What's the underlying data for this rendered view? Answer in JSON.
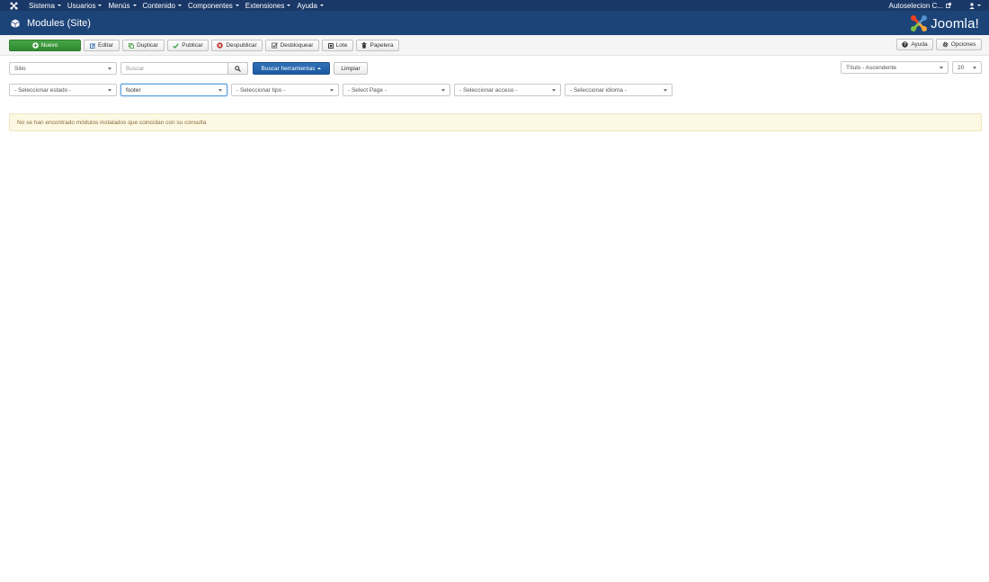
{
  "navbar": {
    "menus": [
      {
        "label": "Sistema"
      },
      {
        "label": "Usuarios"
      },
      {
        "label": "Menús"
      },
      {
        "label": "Contenido"
      },
      {
        "label": "Componentes"
      },
      {
        "label": "Extensiones"
      },
      {
        "label": "Ayuda"
      }
    ],
    "site_link": "Autoselecion C...",
    "user_icon": "user-icon"
  },
  "header": {
    "title": "Modules (Site)",
    "title_icon": "cube-icon",
    "brand": "Joomla!"
  },
  "toolbar": {
    "new": "Nuevo",
    "edit": "Editar",
    "duplicate": "Duplicar",
    "publish": "Publicar",
    "unpublish": "Despublicar",
    "checkin": "Desbloquear",
    "batch": "Lote",
    "trash": "Papelera",
    "help": "Ayuda",
    "options": "Opciones"
  },
  "filters": {
    "client": "Sitio",
    "search_placeholder": "Buscar",
    "search_tools": "Buscar herramientas",
    "clear": "Limpiar",
    "ordering": "Título - Ascendente",
    "limit": "20",
    "state": "- Seleccionar estado -",
    "position": "footer",
    "type": "- Seleccionar tipo -",
    "page": "- Select Page -",
    "access": "- Seleccionar acceso -",
    "language": "- Seleccionar idioma -"
  },
  "alert": {
    "message": "No se han encontrado módulos instalados que coincidan con su consulta"
  },
  "colors": {
    "navbar": "#1a3867",
    "header": "#1d4479",
    "success": "#3a9a3a",
    "primary": "#2163ab",
    "alert_bg": "#fcf8e3",
    "alert_text": "#8a6d3b"
  }
}
